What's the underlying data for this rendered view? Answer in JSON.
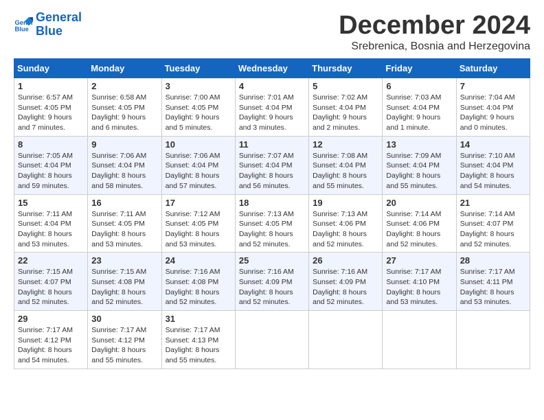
{
  "logo": {
    "line1": "General",
    "line2": "Blue"
  },
  "title": "December 2024",
  "subtitle": "Srebrenica, Bosnia and Herzegovina",
  "days_of_week": [
    "Sunday",
    "Monday",
    "Tuesday",
    "Wednesday",
    "Thursday",
    "Friday",
    "Saturday"
  ],
  "weeks": [
    [
      {
        "day": 1,
        "lines": [
          "Sunrise: 6:57 AM",
          "Sunset: 4:05 PM",
          "Daylight: 9 hours",
          "and 7 minutes."
        ]
      },
      {
        "day": 2,
        "lines": [
          "Sunrise: 6:58 AM",
          "Sunset: 4:05 PM",
          "Daylight: 9 hours",
          "and 6 minutes."
        ]
      },
      {
        "day": 3,
        "lines": [
          "Sunrise: 7:00 AM",
          "Sunset: 4:05 PM",
          "Daylight: 9 hours",
          "and 5 minutes."
        ]
      },
      {
        "day": 4,
        "lines": [
          "Sunrise: 7:01 AM",
          "Sunset: 4:04 PM",
          "Daylight: 9 hours",
          "and 3 minutes."
        ]
      },
      {
        "day": 5,
        "lines": [
          "Sunrise: 7:02 AM",
          "Sunset: 4:04 PM",
          "Daylight: 9 hours",
          "and 2 minutes."
        ]
      },
      {
        "day": 6,
        "lines": [
          "Sunrise: 7:03 AM",
          "Sunset: 4:04 PM",
          "Daylight: 9 hours",
          "and 1 minute."
        ]
      },
      {
        "day": 7,
        "lines": [
          "Sunrise: 7:04 AM",
          "Sunset: 4:04 PM",
          "Daylight: 9 hours",
          "and 0 minutes."
        ]
      }
    ],
    [
      {
        "day": 8,
        "lines": [
          "Sunrise: 7:05 AM",
          "Sunset: 4:04 PM",
          "Daylight: 8 hours",
          "and 59 minutes."
        ]
      },
      {
        "day": 9,
        "lines": [
          "Sunrise: 7:06 AM",
          "Sunset: 4:04 PM",
          "Daylight: 8 hours",
          "and 58 minutes."
        ]
      },
      {
        "day": 10,
        "lines": [
          "Sunrise: 7:06 AM",
          "Sunset: 4:04 PM",
          "Daylight: 8 hours",
          "and 57 minutes."
        ]
      },
      {
        "day": 11,
        "lines": [
          "Sunrise: 7:07 AM",
          "Sunset: 4:04 PM",
          "Daylight: 8 hours",
          "and 56 minutes."
        ]
      },
      {
        "day": 12,
        "lines": [
          "Sunrise: 7:08 AM",
          "Sunset: 4:04 PM",
          "Daylight: 8 hours",
          "and 55 minutes."
        ]
      },
      {
        "day": 13,
        "lines": [
          "Sunrise: 7:09 AM",
          "Sunset: 4:04 PM",
          "Daylight: 8 hours",
          "and 55 minutes."
        ]
      },
      {
        "day": 14,
        "lines": [
          "Sunrise: 7:10 AM",
          "Sunset: 4:04 PM",
          "Daylight: 8 hours",
          "and 54 minutes."
        ]
      }
    ],
    [
      {
        "day": 15,
        "lines": [
          "Sunrise: 7:11 AM",
          "Sunset: 4:04 PM",
          "Daylight: 8 hours",
          "and 53 minutes."
        ]
      },
      {
        "day": 16,
        "lines": [
          "Sunrise: 7:11 AM",
          "Sunset: 4:05 PM",
          "Daylight: 8 hours",
          "and 53 minutes."
        ]
      },
      {
        "day": 17,
        "lines": [
          "Sunrise: 7:12 AM",
          "Sunset: 4:05 PM",
          "Daylight: 8 hours",
          "and 53 minutes."
        ]
      },
      {
        "day": 18,
        "lines": [
          "Sunrise: 7:13 AM",
          "Sunset: 4:05 PM",
          "Daylight: 8 hours",
          "and 52 minutes."
        ]
      },
      {
        "day": 19,
        "lines": [
          "Sunrise: 7:13 AM",
          "Sunset: 4:06 PM",
          "Daylight: 8 hours",
          "and 52 minutes."
        ]
      },
      {
        "day": 20,
        "lines": [
          "Sunrise: 7:14 AM",
          "Sunset: 4:06 PM",
          "Daylight: 8 hours",
          "and 52 minutes."
        ]
      },
      {
        "day": 21,
        "lines": [
          "Sunrise: 7:14 AM",
          "Sunset: 4:07 PM",
          "Daylight: 8 hours",
          "and 52 minutes."
        ]
      }
    ],
    [
      {
        "day": 22,
        "lines": [
          "Sunrise: 7:15 AM",
          "Sunset: 4:07 PM",
          "Daylight: 8 hours",
          "and 52 minutes."
        ]
      },
      {
        "day": 23,
        "lines": [
          "Sunrise: 7:15 AM",
          "Sunset: 4:08 PM",
          "Daylight: 8 hours",
          "and 52 minutes."
        ]
      },
      {
        "day": 24,
        "lines": [
          "Sunrise: 7:16 AM",
          "Sunset: 4:08 PM",
          "Daylight: 8 hours",
          "and 52 minutes."
        ]
      },
      {
        "day": 25,
        "lines": [
          "Sunrise: 7:16 AM",
          "Sunset: 4:09 PM",
          "Daylight: 8 hours",
          "and 52 minutes."
        ]
      },
      {
        "day": 26,
        "lines": [
          "Sunrise: 7:16 AM",
          "Sunset: 4:09 PM",
          "Daylight: 8 hours",
          "and 52 minutes."
        ]
      },
      {
        "day": 27,
        "lines": [
          "Sunrise: 7:17 AM",
          "Sunset: 4:10 PM",
          "Daylight: 8 hours",
          "and 53 minutes."
        ]
      },
      {
        "day": 28,
        "lines": [
          "Sunrise: 7:17 AM",
          "Sunset: 4:11 PM",
          "Daylight: 8 hours",
          "and 53 minutes."
        ]
      }
    ],
    [
      {
        "day": 29,
        "lines": [
          "Sunrise: 7:17 AM",
          "Sunset: 4:12 PM",
          "Daylight: 8 hours",
          "and 54 minutes."
        ]
      },
      {
        "day": 30,
        "lines": [
          "Sunrise: 7:17 AM",
          "Sunset: 4:12 PM",
          "Daylight: 8 hours",
          "and 55 minutes."
        ]
      },
      {
        "day": 31,
        "lines": [
          "Sunrise: 7:17 AM",
          "Sunset: 4:13 PM",
          "Daylight: 8 hours",
          "and 55 minutes."
        ]
      },
      null,
      null,
      null,
      null
    ]
  ]
}
